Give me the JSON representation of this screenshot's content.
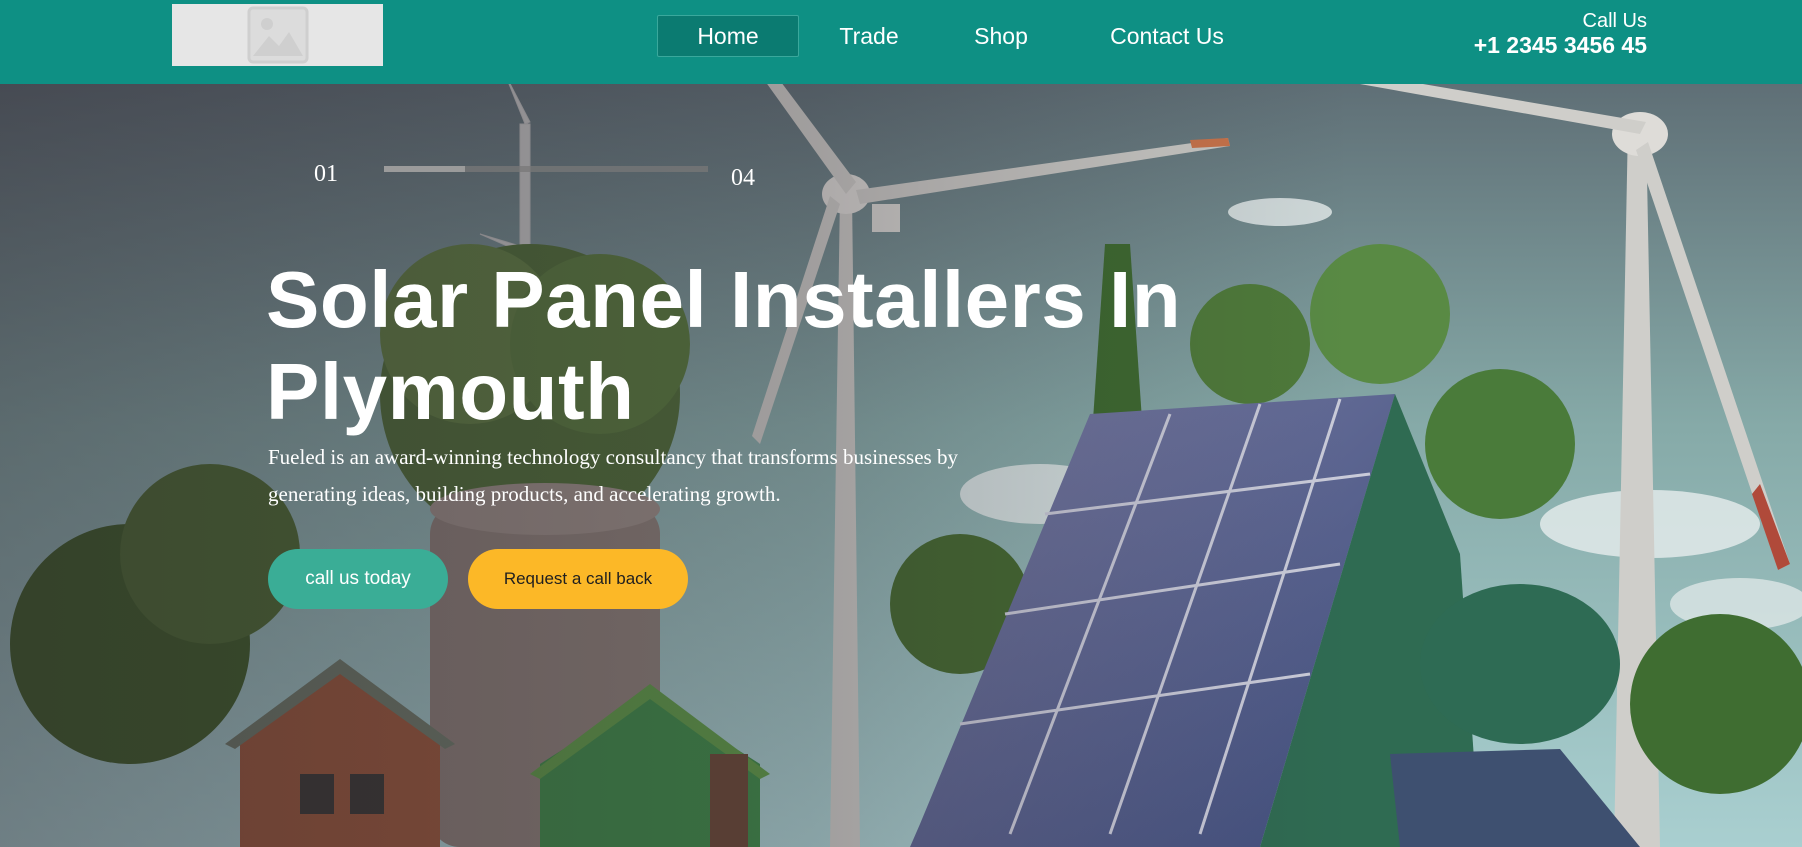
{
  "header": {
    "logo_alt": "image placeholder",
    "nav": [
      {
        "label": "Home",
        "active": true
      },
      {
        "label": "Trade",
        "active": false
      },
      {
        "label": "Shop",
        "active": false
      },
      {
        "label": "Contact Us",
        "active": false
      }
    ],
    "call_label": "Call Us",
    "phone": "+1 2345 3456 45"
  },
  "hero": {
    "slide_current": "01",
    "slide_total": "04",
    "slide_progress_fraction": 0.25,
    "title": "Solar Panel Installers In Plymouth",
    "description": "Fueled is an award-winning technology consultancy that transforms businesses by generating ideas, building products, and accelerating growth.",
    "primary_button": "call us today",
    "secondary_button": "Request a call back"
  },
  "colors": {
    "header_bg": "#0e9084",
    "nav_active_bg": "#0b7b71",
    "primary_button": "#3aad96",
    "secondary_button": "#fcb827",
    "text": "#ffffff"
  }
}
